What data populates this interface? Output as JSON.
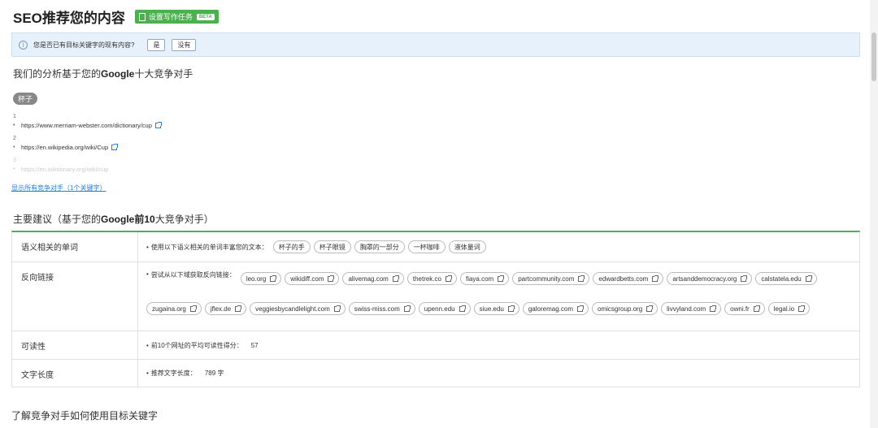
{
  "header": {
    "title": "SEO推荐您的内容",
    "task_button": "设置写作任务",
    "task_badge": "BETA"
  },
  "info_bar": {
    "question": "您是否已有目标关键字的现有内容?",
    "yes": "是",
    "no": "没有"
  },
  "analysis": {
    "prefix": "我们的分析基于您的",
    "brand": "Google",
    "suffix": "十大竞争对手"
  },
  "keyword": "杯子",
  "competitors": [
    {
      "num": "1",
      "url": "https://www.merriam-webster.com/dictionary/cup"
    },
    {
      "num": "2",
      "url": "https://en.wikipedia.org/wiki/Cup"
    },
    {
      "num": "3",
      "url": "https://en.wiktionary.org/wiki/cup"
    }
  ],
  "show_all_link": "显示所有竞争对手（1个关键字）",
  "main_heading": {
    "prefix": "主要建议（基于您的",
    "brand": "Google前10",
    "suffix": "大竞争对手）"
  },
  "semantic": {
    "label": "语义相关的单词",
    "lead": "使用以下语义相关的单词丰富您的文本：",
    "words": [
      "杯子的手",
      "杯子眼镜",
      "胸罩的一部分",
      "一杯咖啡",
      "液体量词"
    ]
  },
  "backlinks": {
    "label": "反向链接",
    "lead": "尝试从以下域获取反向链接：",
    "domains": [
      "leo.org",
      "wikidiff.com",
      "alivemag.com",
      "thetrek.co",
      "fiaya.com",
      "partcommunity.com",
      "edwardbetts.com",
      "artsanddemocracy.org",
      "calstatela.edu",
      "zugaina.org",
      "jflex.de",
      "veggiesbycandlelight.com",
      "swiss-miss.com",
      "upenn.edu",
      "siue.edu",
      "galoremag.com",
      "omicsgroup.org",
      "livvyland.com",
      "owni.fr",
      "legal.io"
    ]
  },
  "readability": {
    "label": "可读性",
    "lead": "前10个网址的平均可读性得分：",
    "value": "57"
  },
  "text_length": {
    "label": "文字长度",
    "lead": "推荐文字长度：",
    "value": "789 字"
  },
  "bottom_heading": "了解竞争对手如何使用目标关键字"
}
